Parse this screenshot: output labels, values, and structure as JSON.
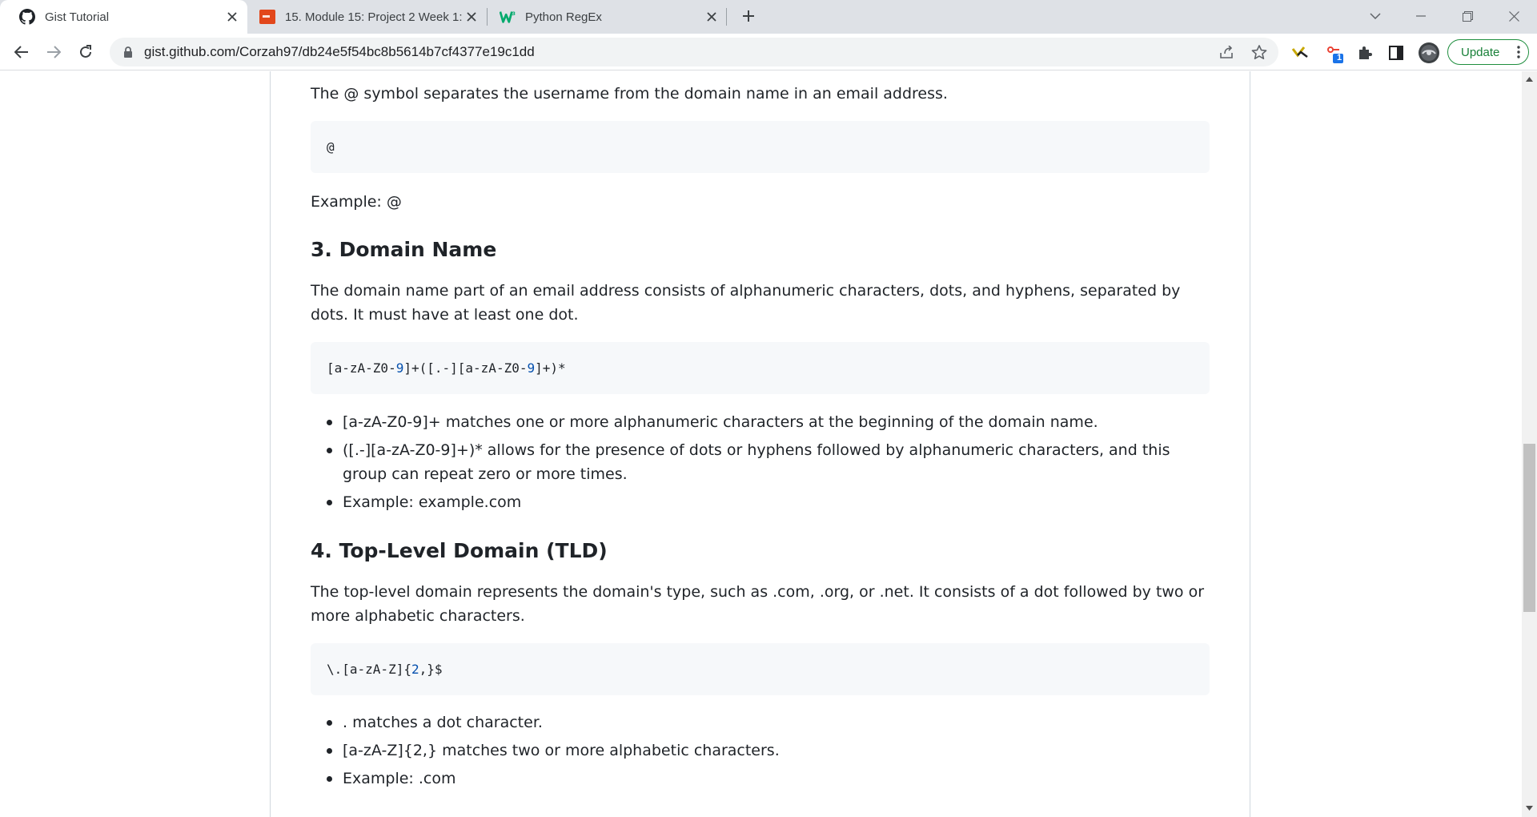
{
  "tabs": [
    {
      "title": "Gist Tutorial",
      "icon": "github-icon",
      "active": true
    },
    {
      "title": "15. Module 15: Project 2 Week 1:",
      "icon": "module-icon",
      "active": false
    },
    {
      "title": "Python RegEx",
      "icon": "w3schools-icon",
      "active": false
    }
  ],
  "address_bar": {
    "url": "gist.github.com/Corzah97/db24e5f54bc8b5614b7cf4377e19c1dd"
  },
  "update_button": {
    "label": "Update"
  },
  "extension_badge": "1",
  "article": {
    "intro_text": "The @ symbol separates the username from the domain name in an email address.",
    "at_code": "@",
    "at_example": "Example: @",
    "section3": {
      "heading": "3. Domain Name",
      "paragraph": "The domain name part of an email address consists of alphanumeric characters, dots, and hyphens, separated by dots. It must have at least one dot.",
      "code_parts": [
        "[a-zA-Z0-",
        "9",
        "]+([.-][a-zA-Z0-",
        "9",
        "]+)*"
      ],
      "bullets": [
        "[a-zA-Z0-9]+ matches one or more alphanumeric characters at the beginning of the domain name.",
        "([.-][a-zA-Z0-9]+)* allows for the presence of dots or hyphens followed by alphanumeric characters, and this group can repeat zero or more times.",
        "Example: example.com"
      ]
    },
    "section4": {
      "heading": "4. Top-Level Domain (TLD)",
      "paragraph": "The top-level domain represents the domain's type, such as .com, .org, or .net. It consists of a dot followed by two or more alphabetic characters.",
      "code_parts": [
        "\\.[a-zA-Z]{",
        "2",
        ",}$"
      ],
      "bullets": [
        ". matches a dot character.",
        "[a-zA-Z]{2,} matches two or more alphabetic characters.",
        "Example: .com"
      ]
    }
  },
  "colors": {
    "tabstrip": "#dee1e6",
    "code_background": "#f6f8fa",
    "code_number": "#0550ae",
    "update_green": "#188038"
  }
}
